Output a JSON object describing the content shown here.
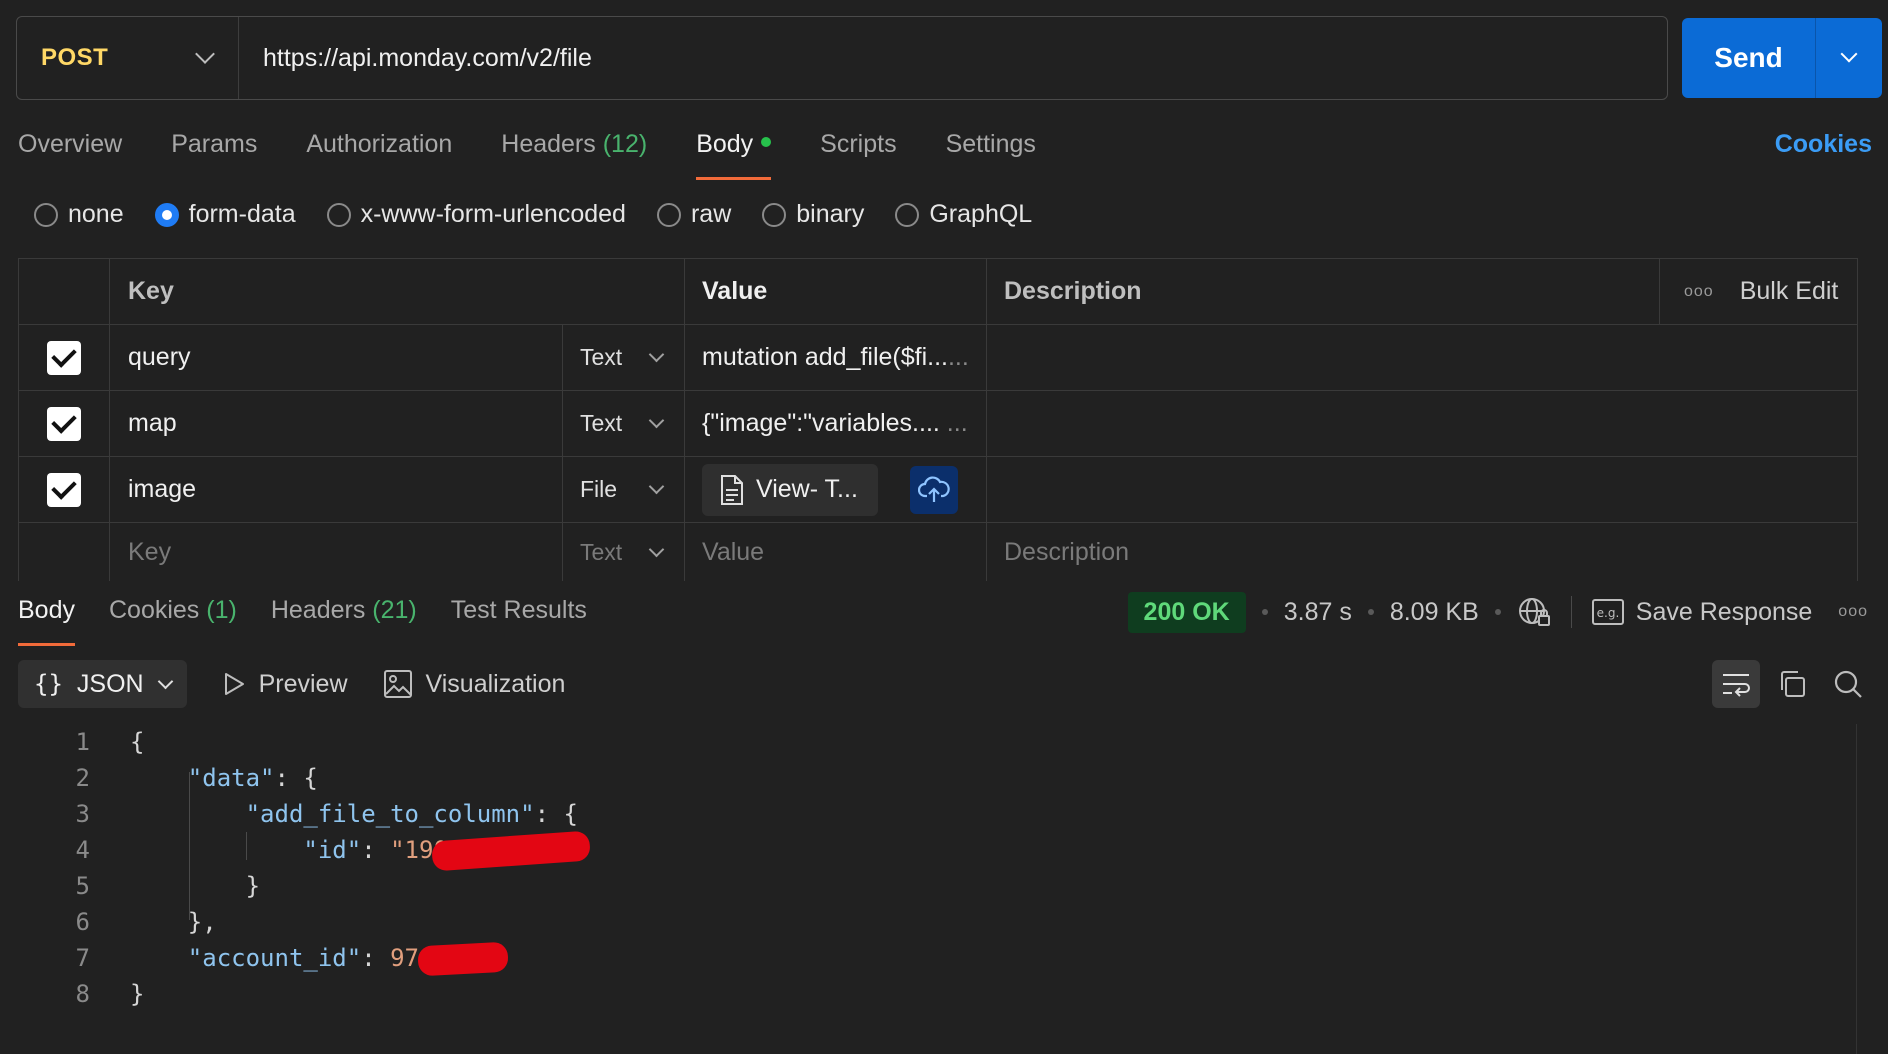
{
  "request": {
    "method": "POST",
    "url": "https://api.monday.com/v2/file",
    "send_label": "Send"
  },
  "request_tabs": [
    {
      "label": "Overview",
      "count": ""
    },
    {
      "label": "Params",
      "count": ""
    },
    {
      "label": "Authorization",
      "count": ""
    },
    {
      "label": "Headers",
      "count": "(12)"
    },
    {
      "label": "Body",
      "count": ""
    },
    {
      "label": "Scripts",
      "count": ""
    },
    {
      "label": "Settings",
      "count": ""
    }
  ],
  "cookies_link": "Cookies",
  "body_types": [
    "none",
    "form-data",
    "x-www-form-urlencoded",
    "raw",
    "binary",
    "GraphQL"
  ],
  "selected_body_type": "form-data",
  "table": {
    "headers": {
      "key": "Key",
      "value": "Value",
      "description": "Description",
      "bulk_edit": "Bulk Edit"
    },
    "rows": [
      {
        "key": "query",
        "type": "Text",
        "value": "mutation add_file($fi...",
        "value_more": "..."
      },
      {
        "key": "map",
        "type": "Text",
        "value": "{\"image\":\"variables....",
        "value_more": "..."
      },
      {
        "key": "image",
        "type": "File",
        "value": "View- T..."
      }
    ],
    "new_row": {
      "key": "Key",
      "type": "Text",
      "value": "Value",
      "description": "Description"
    }
  },
  "response": {
    "tabs": [
      {
        "label": "Body",
        "count": ""
      },
      {
        "label": "Cookies",
        "count": "(1)"
      },
      {
        "label": "Headers",
        "count": "(21)"
      },
      {
        "label": "Test Results",
        "count": ""
      }
    ],
    "status": "200 OK",
    "time": "3.87 s",
    "size": "8.09 KB",
    "save_response": "Save Response",
    "format": "JSON",
    "preview": "Preview",
    "visualization": "Visualization"
  },
  "code_lines": [
    {
      "n": "1"
    },
    {
      "n": "2"
    },
    {
      "n": "3"
    },
    {
      "n": "4"
    },
    {
      "n": "5"
    },
    {
      "n": "6"
    },
    {
      "n": "7"
    },
    {
      "n": "8"
    }
  ],
  "code": {
    "open": "{",
    "data_key": "\"data\"",
    "add_file_key": "\"add_file_to_column\"",
    "id_key": "\"id\"",
    "id_val": "\"190",
    "account_key": "\"account_id\"",
    "account_val": "97",
    "close_inner": "}",
    "close_data": "},",
    "close": "}"
  }
}
